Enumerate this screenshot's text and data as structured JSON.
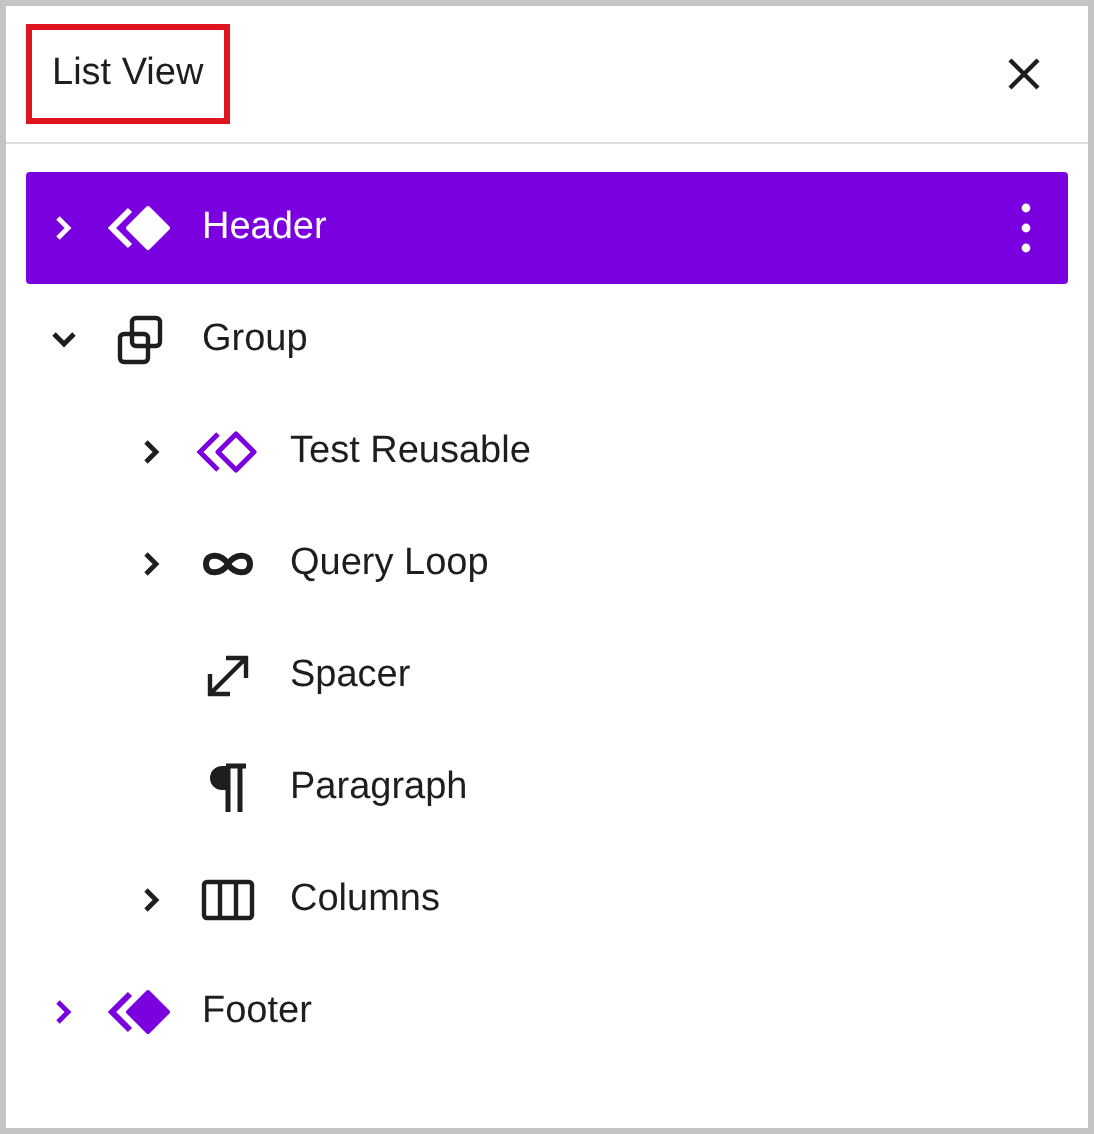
{
  "panel": {
    "title": "List View"
  },
  "items": [
    {
      "label": "Header",
      "kind": "template-part",
      "selected": true,
      "expanded": false
    },
    {
      "label": "Group",
      "kind": "group",
      "selected": false,
      "expanded": true,
      "children": [
        {
          "label": "Test Reusable",
          "kind": "reusable",
          "selected": false,
          "expanded": false
        },
        {
          "label": "Query Loop",
          "kind": "loop",
          "selected": false,
          "expanded": false
        },
        {
          "label": "Spacer",
          "kind": "spacer",
          "selected": false
        },
        {
          "label": "Paragraph",
          "kind": "paragraph",
          "selected": false
        },
        {
          "label": "Columns",
          "kind": "columns",
          "selected": false,
          "expanded": false
        }
      ]
    },
    {
      "label": "Footer",
      "kind": "template-part",
      "selected": false,
      "expanded": false
    }
  ]
}
